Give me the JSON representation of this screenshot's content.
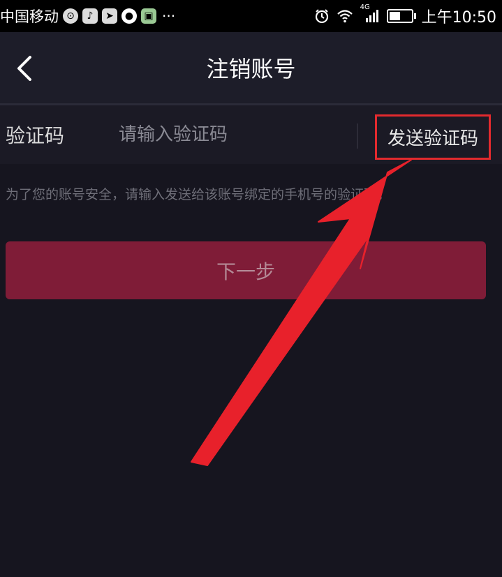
{
  "status_bar": {
    "carrier": "中国移动",
    "app_icons": [
      "notification-icon",
      "tiktok-icon",
      "telegram-icon",
      "chat-icon",
      "app-icon"
    ],
    "more": "···",
    "network": "4G",
    "time": "上午10:50",
    "battery_level": 0.5
  },
  "nav": {
    "back_icon": "chevron-left-icon",
    "title": "注销账号"
  },
  "verification": {
    "label": "验证码",
    "placeholder": "请输入验证码",
    "send_button": "发送验证码"
  },
  "hint": "为了您的账号安全，请输入发送给该账号绑定的手机号的验证码。",
  "next_button": "下一步",
  "colors": {
    "background": "#16151f",
    "nav_background": "#1d1d29",
    "button_background": "#7f1c37",
    "highlight_box": "#e32a2e",
    "arrow": "#e8212b"
  }
}
